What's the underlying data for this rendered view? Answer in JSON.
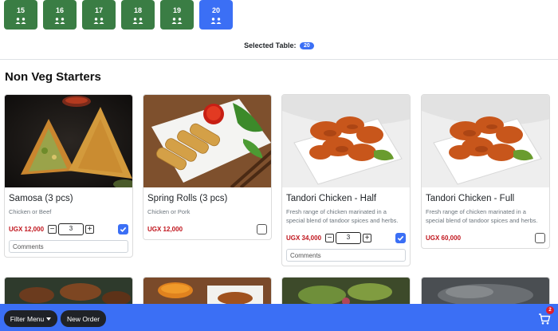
{
  "tables": [
    {
      "number": "15",
      "active": false
    },
    {
      "number": "16",
      "active": false
    },
    {
      "number": "17",
      "active": false
    },
    {
      "number": "18",
      "active": false
    },
    {
      "number": "19",
      "active": false
    },
    {
      "number": "20",
      "active": true
    }
  ],
  "selected_table": {
    "label": "Selected Table:",
    "value": "20"
  },
  "section_title": "Non Veg Starters",
  "items": [
    {
      "name": "Samosa (3 pcs)",
      "desc": "Chicken or Beef",
      "price": "UGX 12,000",
      "qty": "3",
      "checked": true,
      "comments_placeholder": "Comments"
    },
    {
      "name": "Spring Rolls (3 pcs)",
      "desc": "Chicken or Pork",
      "price": "UGX 12,000",
      "checked": false
    },
    {
      "name": "Tandori Chicken - Half",
      "desc": "Fresh range of chicken marinated in a special blend of tandoor spices and herbs.",
      "price": "UGX 34,000",
      "qty": "3",
      "checked": true,
      "comments_placeholder": "Comments"
    },
    {
      "name": "Tandori Chicken - Full",
      "desc": "Fresh range of chicken marinated in a special blend of tandoor spices and herbs.",
      "price": "UGX 60,000",
      "checked": false
    }
  ],
  "stepper": {
    "minus": "−",
    "plus": "+"
  },
  "bottom_bar": {
    "filter_label": "Filter Menu",
    "new_order_label": "New Order",
    "cart_count": "2"
  },
  "icons": {
    "table": "people-icon",
    "cart": "cart-icon",
    "check": "check-icon",
    "caret": "caret-down-icon"
  },
  "colors": {
    "table_green": "#3a7d44",
    "accent_blue": "#3b6ff5",
    "price_red": "#c0141c",
    "bar_button": "#1f2227"
  }
}
